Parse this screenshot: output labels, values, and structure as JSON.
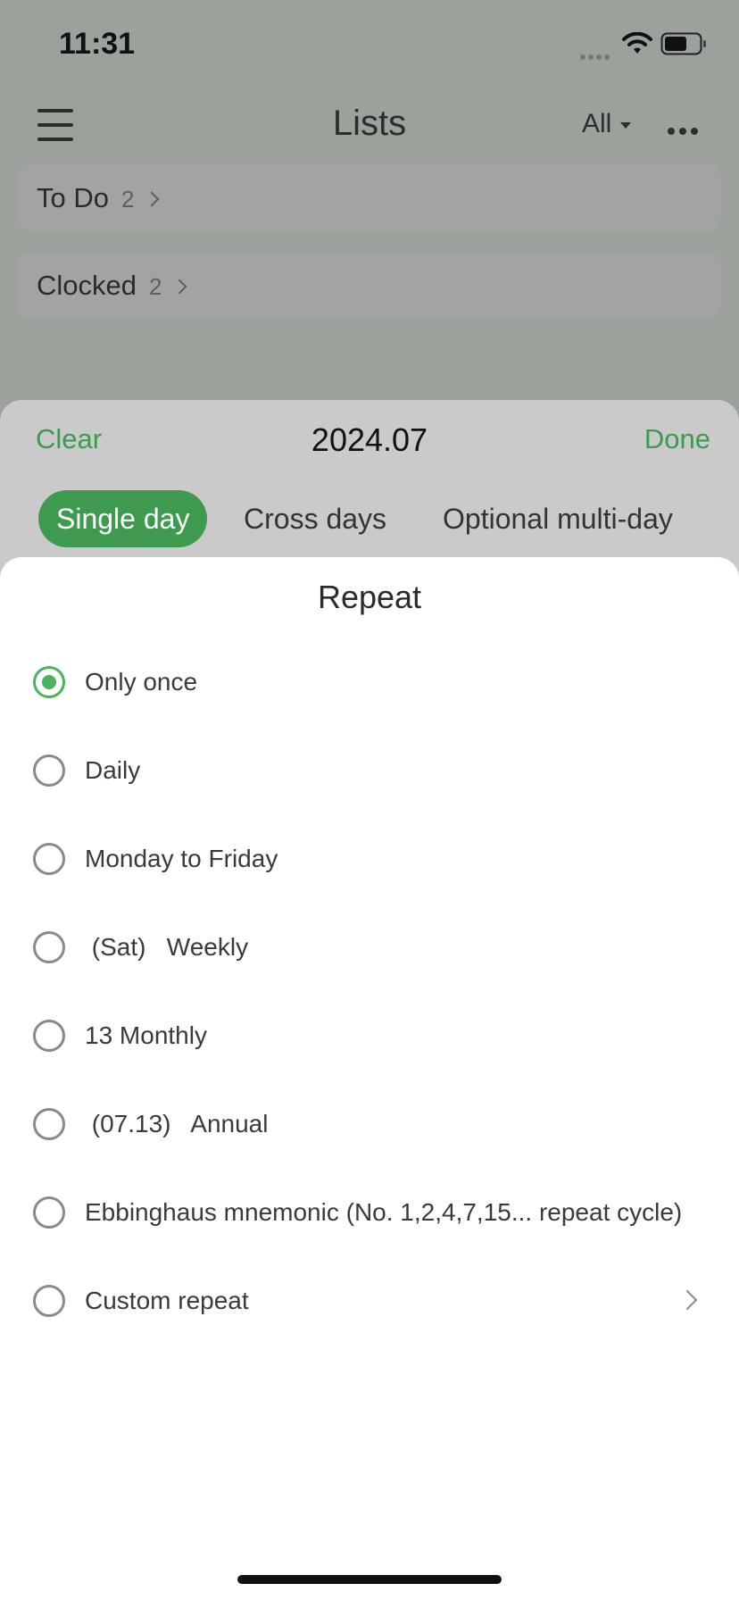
{
  "status_bar": {
    "time": "11:31",
    "battery_level": 0.65
  },
  "nav": {
    "title": "Lists",
    "filter_label": "All"
  },
  "lists": [
    {
      "name": "To Do",
      "count": "2"
    },
    {
      "name": "Clocked",
      "count": "2"
    }
  ],
  "date_sheet": {
    "clear_label": "Clear",
    "month": "2024.07",
    "done_label": "Done",
    "modes": [
      "Single day",
      "Cross days",
      "Optional multi-day"
    ],
    "selected_mode": "Single day"
  },
  "repeat_sheet": {
    "title": "Repeat",
    "options": [
      {
        "label": "Only once",
        "selected": true
      },
      {
        "label": "Daily",
        "selected": false
      },
      {
        "label": "Monday to Friday",
        "selected": false
      },
      {
        "label": " (Sat)   Weekly",
        "selected": false
      },
      {
        "label": "13 Monthly",
        "selected": false
      },
      {
        "label": " (07.13)   Annual",
        "selected": false
      },
      {
        "label": "Ebbinghaus mnemonic (No. 1,2,4,7,15... repeat cycle)",
        "selected": false
      },
      {
        "label": "Custom repeat",
        "selected": false,
        "has_chevron": true
      }
    ]
  },
  "colors": {
    "accent": "#3e9a4f",
    "radio_selected": "#4bb35f"
  }
}
